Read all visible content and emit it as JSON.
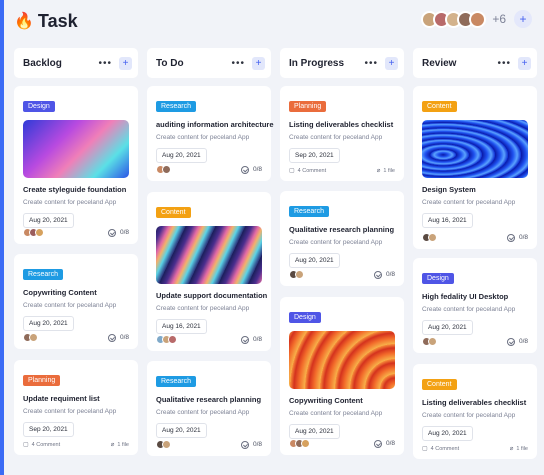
{
  "header": {
    "title": "Task",
    "extra_count": "+6",
    "add_label": "+"
  },
  "avatar_colors": [
    "#c9a37a",
    "#b86a6a",
    "#d3b28c",
    "#8f6b5a",
    "#c98963"
  ],
  "columns": [
    {
      "title": "Backlog",
      "menu": "•••",
      "add": "+"
    },
    {
      "title": "To Do",
      "menu": "•••",
      "add": "+"
    },
    {
      "title": "In Progress",
      "menu": "•••",
      "add": "+"
    },
    {
      "title": "Review",
      "menu": "•••",
      "add": "+"
    }
  ],
  "cards": {
    "backlog": [
      {
        "tag": "Design",
        "title": "Create styleguide foundation",
        "subtitle": "Create content for peceland App",
        "date": "Aug 20, 2021",
        "progress": "0/8"
      },
      {
        "tag": "Research",
        "title": "Copywriting Content",
        "subtitle": "Create content for peceland App",
        "date": "Aug 20, 2021",
        "progress": "0/8"
      },
      {
        "tag": "Planning",
        "title": "Update requiment list",
        "subtitle": "Create content for peceland App",
        "date": "Sep 20, 2021",
        "comments": "4 Comment",
        "files": "1 file"
      }
    ],
    "todo": [
      {
        "tag": "Research",
        "title": "auditing information architecture",
        "subtitle": "Create content for peceland App",
        "date": "Aug 20, 2021",
        "progress": "0/8"
      },
      {
        "tag": "Content",
        "title": "Update support documentation",
        "subtitle": "Create content for peceland App",
        "date": "Aug 16, 2021",
        "progress": "0/8"
      },
      {
        "tag": "Research",
        "title": "Qualitative research planning",
        "subtitle": "Create content for peceland App",
        "date": "Aug 20, 2021",
        "progress": "0/8"
      }
    ],
    "inprogress": [
      {
        "tag": "Planning",
        "title": "Listing deliverables checklist",
        "subtitle": "Create content for peceland App",
        "date": "Sep 20, 2021",
        "comments": "4 Comment",
        "files": "1 file"
      },
      {
        "tag": "Research",
        "title": "Qualitative research planning",
        "subtitle": "Create content for peceland App",
        "date": "Aug 20, 2021",
        "progress": "0/8"
      },
      {
        "tag": "Design",
        "title": "Copywriting Content",
        "subtitle": "Create content for peceland App",
        "date": "Aug 20, 2021",
        "progress": "0/8"
      }
    ],
    "review": [
      {
        "tag": "Content",
        "title": "Design System",
        "subtitle": "Create content for peceland App",
        "date": "Aug 16, 2021",
        "progress": "0/8"
      },
      {
        "tag": "Design",
        "title": "High fedality UI Desktop",
        "subtitle": "Create content for peceland App",
        "date": "Aug 20, 2021",
        "progress": "0/8"
      },
      {
        "tag": "Content",
        "title": "Listing deliverables checklist",
        "subtitle": "Create content for peceland App",
        "date": "Aug 20, 2021",
        "comments": "4 Comment",
        "files": "1 file"
      }
    ]
  },
  "colors": {
    "accent": "#3b6bf5",
    "design": "#4f55e6",
    "research": "#1e9be3",
    "content": "#f3a113",
    "planning": "#ea6c3c"
  }
}
